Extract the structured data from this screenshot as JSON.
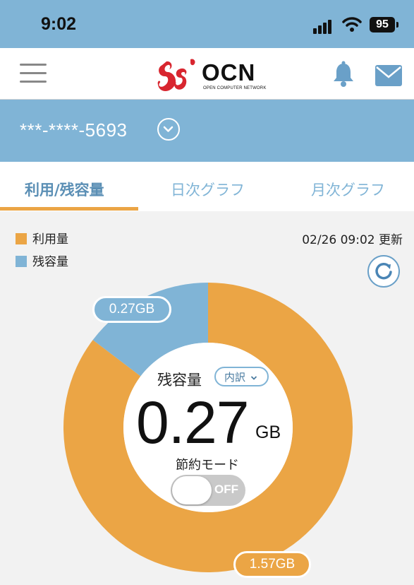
{
  "status_bar": {
    "time": "9:02",
    "battery": "95"
  },
  "header": {
    "logo_text": "OCN",
    "logo_subtitle": "OPEN COMPUTER NETWORK"
  },
  "account": {
    "number": "***-****-5693"
  },
  "tabs": [
    {
      "label": "利用/残容量",
      "active": true
    },
    {
      "label": "日次グラフ",
      "active": false
    },
    {
      "label": "月次グラフ",
      "active": false
    }
  ],
  "legend": [
    {
      "label": "利用量",
      "color": "#eba545"
    },
    {
      "label": "残容量",
      "color": "#80b4d6"
    }
  ],
  "updated_at": "02/26 09:02 更新",
  "gauge": {
    "center_label": "残容量",
    "breakdown_label": "内訳",
    "value": "0.27",
    "unit": "GB",
    "saving_mode_label": "節約モード",
    "saving_mode_state": "OFF",
    "remaining_label": "0.27GB",
    "used_label": "1.57GB"
  },
  "chart_data": {
    "type": "pie",
    "donut": true,
    "slices": [
      {
        "label": "利用量",
        "value": 1.57,
        "color": "#eba545"
      },
      {
        "label": "残容量",
        "value": 0.27,
        "color": "#80b4d6"
      }
    ]
  },
  "colors": {
    "accent": "#eba545",
    "brand_blue": "#80b4d6",
    "logo_red": "#d8262f"
  }
}
